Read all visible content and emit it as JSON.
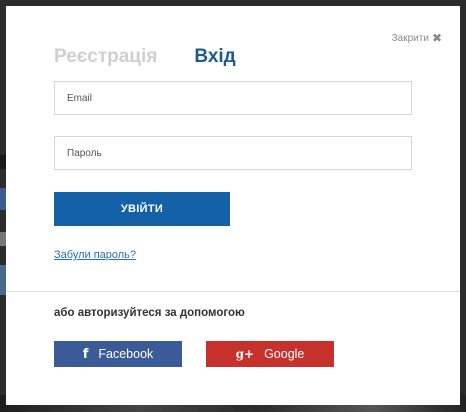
{
  "modal": {
    "close_label": "Закрити",
    "tabs": [
      {
        "label": "Реєстрація",
        "active": false
      },
      {
        "label": "Вхід",
        "active": true
      }
    ],
    "email": {
      "value": "",
      "placeholder": "Email"
    },
    "password": {
      "value": "",
      "placeholder": "Пароль"
    },
    "submit_label": "УВІЙТИ",
    "forgot_label": "Забули пароль?",
    "social_label": "або авторизуйтеся за допомогою",
    "facebook": {
      "icon": "f",
      "label": "Facebook",
      "color": "#3a5a98"
    },
    "google": {
      "icon": "g+",
      "label": "Google",
      "color": "#c6312d"
    }
  },
  "colors": {
    "accent": "#1561a8",
    "active_tab": "#1b5a91",
    "link": "#2a6fb3"
  }
}
